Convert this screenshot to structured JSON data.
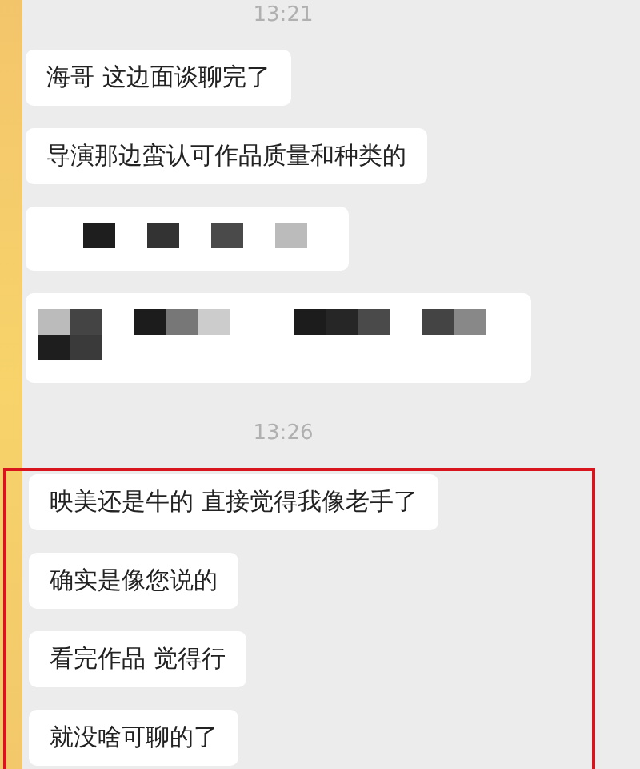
{
  "items": [
    {
      "kind": "time",
      "text": "13:21"
    },
    {
      "kind": "text",
      "text": "海哥 这边面谈聊完了"
    },
    {
      "kind": "text",
      "text": "导演那边蛮认可作品质量和种类的"
    },
    {
      "kind": "redacted"
    },
    {
      "kind": "redacted"
    },
    {
      "kind": "time",
      "text": "13:26"
    }
  ],
  "highlighted": [
    {
      "kind": "text",
      "text": "映美还是牛的 直接觉得我像老手了"
    },
    {
      "kind": "text",
      "text": "确实是像您说的"
    },
    {
      "kind": "text",
      "text": "看完作品 觉得行"
    },
    {
      "kind": "text",
      "text": "就没啥可聊的了"
    }
  ]
}
